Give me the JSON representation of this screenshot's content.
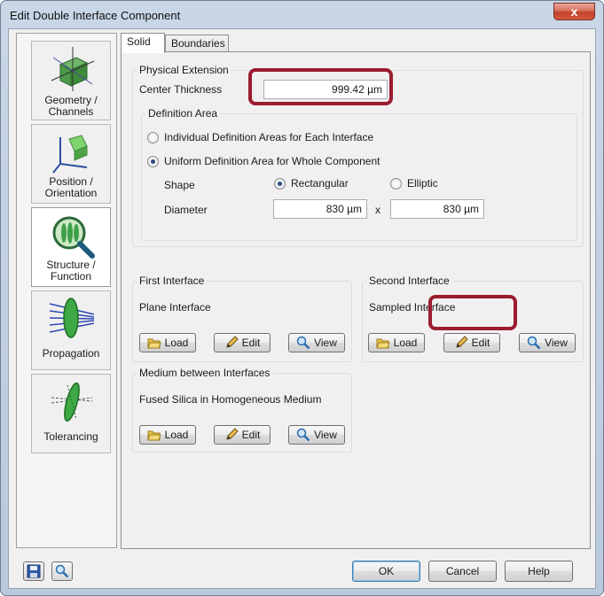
{
  "window": {
    "title": "Edit Double Interface Component",
    "close_glyph": "x"
  },
  "nav": {
    "items": [
      {
        "label": "Geometry / Channels",
        "icon": "geometry-cube-icon"
      },
      {
        "label": "Position / Orientation",
        "icon": "position-axes-icon"
      },
      {
        "label": "Structure / Function",
        "icon": "structure-magnifier-icon",
        "selected": true
      },
      {
        "label": "Propagation",
        "icon": "propagation-lens-icon"
      },
      {
        "label": "Tolerancing",
        "icon": "tolerancing-lens-icon"
      }
    ]
  },
  "tabs": [
    {
      "label": "Solid",
      "active": true
    },
    {
      "label": "Boundaries",
      "active": false
    }
  ],
  "physical_extension": {
    "title": "Physical Extension",
    "center_thickness_label": "Center Thickness",
    "center_thickness_value": "999.42 µm",
    "definition_area": {
      "title": "Definition Area",
      "option_individual": "Individual Definition Areas for Each Interface",
      "option_uniform": "Uniform Definition Area for Whole Component",
      "selected": "uniform",
      "shape_label": "Shape",
      "shape_rect": "Rectangular",
      "shape_ellip": "Elliptic",
      "shape_selected": "rect",
      "diameter_label": "Diameter",
      "diameter_x": "830 µm",
      "times": "x",
      "diameter_y": "830 µm"
    }
  },
  "first_interface": {
    "title": "First Interface",
    "value": "Plane Interface",
    "load": "Load",
    "edit": "Edit",
    "view": "View"
  },
  "second_interface": {
    "title": "Second Interface",
    "value": "Sampled Interface",
    "load": "Load",
    "edit": "Edit",
    "view": "View"
  },
  "medium": {
    "title": "Medium between Interfaces",
    "value": "Fused Silica in Homogeneous Medium",
    "load": "Load",
    "edit": "Edit",
    "view": "View"
  },
  "footer": {
    "ok": "OK",
    "cancel": "Cancel",
    "help": "Help"
  },
  "colors": {
    "highlight": "#9b1b2f",
    "accent": "#3c7fb1"
  }
}
